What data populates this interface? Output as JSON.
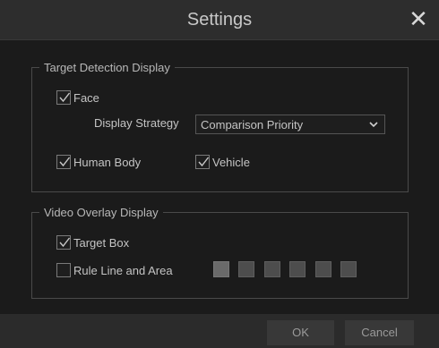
{
  "dialog": {
    "title": "Settings",
    "close_glyph": "✕"
  },
  "target_detection": {
    "legend": "Target Detection Display",
    "face": {
      "label": "Face",
      "checked": true
    },
    "display_strategy": {
      "label": "Display Strategy",
      "value": "Comparison Priority"
    },
    "human_body": {
      "label": "Human Body",
      "checked": true
    },
    "vehicle": {
      "label": "Vehicle",
      "checked": true
    }
  },
  "video_overlay": {
    "legend": "Video Overlay Display",
    "target_box": {
      "label": "Target Box",
      "checked": true
    },
    "rule_line_area": {
      "label": "Rule Line and Area",
      "checked": false
    },
    "color_swatches": [
      "#6a6a6a",
      "#4d4d4d",
      "#4d4d4d",
      "#4d4d4d",
      "#4d4d4d",
      "#4d4d4d"
    ]
  },
  "footer": {
    "ok_label": "OK",
    "cancel_label": "Cancel"
  },
  "icons": {
    "close": "close-icon",
    "check": "checkmark-icon",
    "dropdown": "chevron-down-icon"
  }
}
